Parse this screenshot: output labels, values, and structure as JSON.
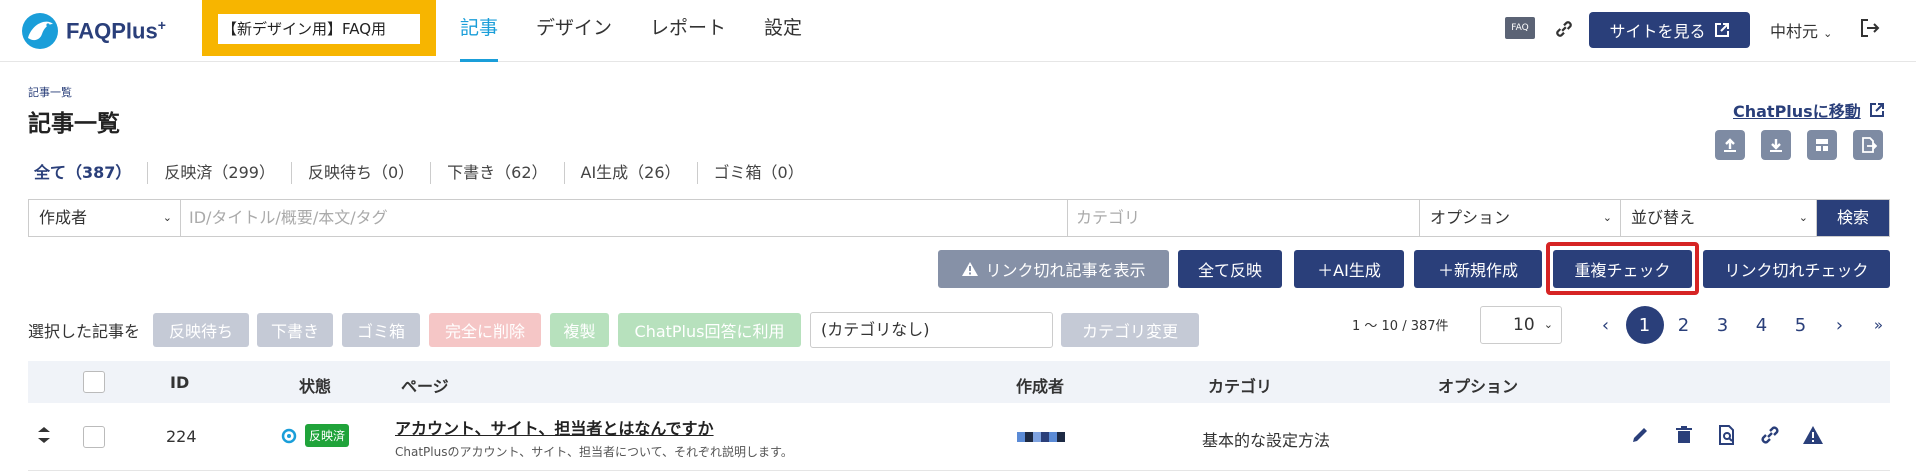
{
  "header": {
    "logo_text": "FAQPlus",
    "logo_sup": "+",
    "site_selector": "【新デザイン用】FAQ用",
    "nav": [
      "記事",
      "デザイン",
      "レポート",
      "設定"
    ],
    "faq_badge": "FAQ",
    "view_site": "サイトを見る",
    "user": "中村元"
  },
  "page": {
    "breadcrumb": "記事一覧",
    "title": "記事一覧",
    "chatplus_link": "ChatPlusに移動"
  },
  "tabs": [
    "全て（387）",
    "反映済（299）",
    "反映待ち（0）",
    "下書き（62）",
    "AI生成（26）",
    "ゴミ箱（0）"
  ],
  "filter": {
    "author": "作成者",
    "keyword_placeholder": "ID/タイトル/概要/本文/タグ",
    "category_placeholder": "カテゴリ",
    "option": "オプション",
    "sort": "並び替え",
    "search": "検索"
  },
  "actions": {
    "show_broken": "リンク切れ記事を表示",
    "publish_all": "全て反映",
    "ai_generate": "＋AI生成",
    "new_article": "＋新規作成",
    "dup_check": "重複チェック",
    "link_check": "リンク切れチェック"
  },
  "bulk": {
    "label": "選択した記事を",
    "pending": "反映待ち",
    "draft": "下書き",
    "trash": "ゴミ箱",
    "delete": "完全に削除",
    "copy": "複製",
    "use_chatplus": "ChatPlus回答に利用",
    "category_value": "(カテゴリなし)",
    "change_category": "カテゴリ変更"
  },
  "pagination": {
    "count": "1 〜 10 / 387件",
    "per_page": "10",
    "prev": "‹",
    "pages": [
      "1",
      "2",
      "3",
      "4",
      "5"
    ],
    "next": "›",
    "last": "»",
    "current": "1"
  },
  "table": {
    "headers": {
      "id": "ID",
      "status": "状態",
      "page": "ページ",
      "author": "作成者",
      "category": "カテゴリ",
      "option": "オプション"
    },
    "rows": [
      {
        "id": "224",
        "status": "反映済",
        "title": "アカウント、サイト、担当者とはなんですか",
        "summary": "ChatPlusのアカウント、サイト、担当者について、それぞれ説明します。",
        "category": "基本的な設定方法"
      }
    ]
  },
  "colors": {
    "primary": "#2a3f7a",
    "accent": "#1a9ed9",
    "highlight_box": "#d62424",
    "site_selector_bg": "#f7b500",
    "status_published": "#20a33a"
  }
}
